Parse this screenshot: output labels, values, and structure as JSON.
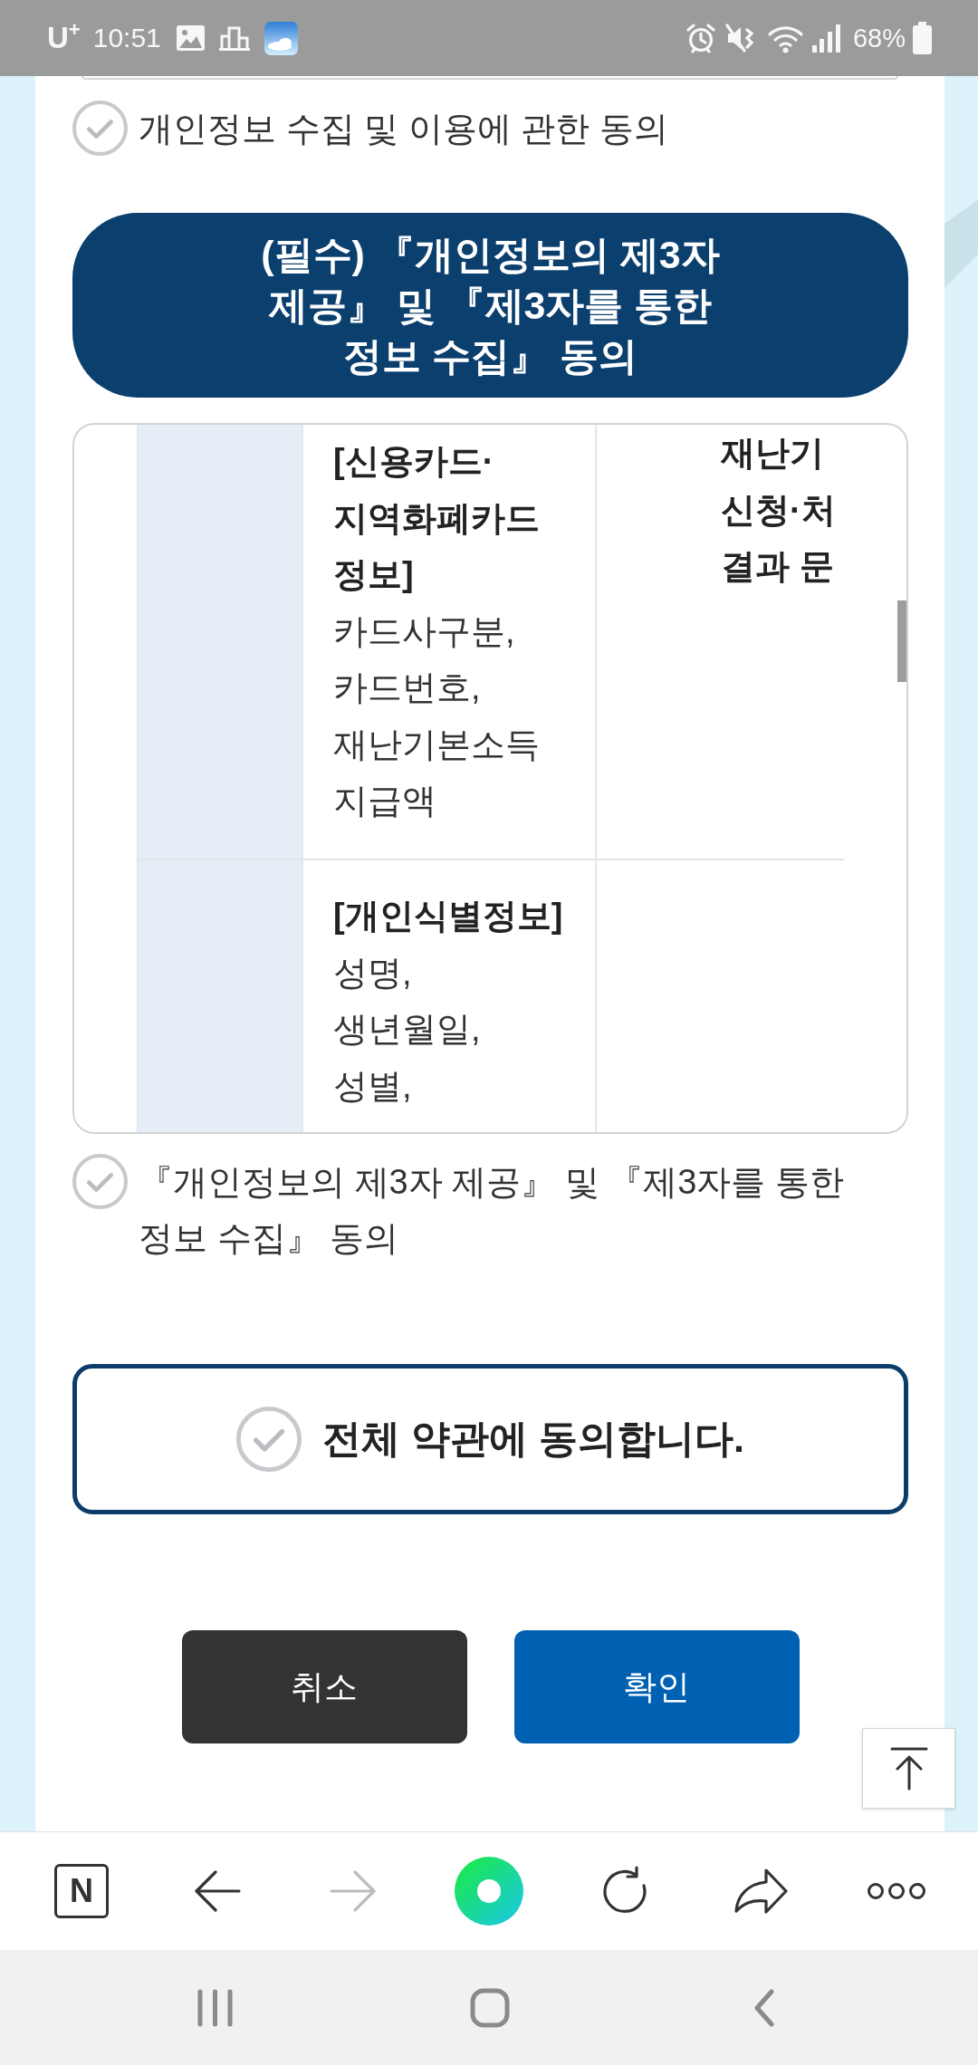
{
  "status_bar": {
    "carrier": "U$^{+}$",
    "time": "10:51",
    "battery": "68%"
  },
  "privacy_consent": {
    "label": "개인정보 수집 및 이용에 관한 동의",
    "checked": false
  },
  "third_party": {
    "title": "(필수) 『개인정보의 제3자 제공』 및 『제3자를 통한 정보 수집』 동의",
    "table": {
      "rows": [
        {
          "column_2": {
            "heading_lines": [
              "[신용카드·",
              "지역화폐카드",
              "정보]"
            ],
            "lines": [
              "카드사구분,",
              "카드번호,",
              "재난기본소득",
              "지급액"
            ]
          },
          "column_3": {
            "heading_lines": [
              "재난기",
              "신청·처",
              "결과 문"
            ]
          }
        },
        {
          "column_2": {
            "heading_lines": [
              "[개인식별정보]"
            ],
            "lines": [
              "성명,",
              "생년월일,",
              "성별,"
            ]
          }
        }
      ]
    },
    "consent": {
      "label": "『개인정보의 제3자 제공』 및 『제3자를 통한 정보 수집』 동의",
      "checked": false
    }
  },
  "agree_all": {
    "label": "전체 약관에 동의합니다.",
    "checked": false
  },
  "buttons": [
    {
      "label": "취소",
      "kind": "cancel"
    },
    {
      "label": "확인",
      "kind": "confirm"
    }
  ],
  "browser_toolbar": {
    "items": [
      {
        "kind": "home",
        "label": "N",
        "disabled": false
      },
      {
        "kind": "back",
        "disabled": false
      },
      {
        "kind": "forward",
        "disabled": true
      },
      {
        "kind": "assistant",
        "disabled": false
      },
      {
        "kind": "reload",
        "disabled": false
      },
      {
        "kind": "share",
        "disabled": false
      },
      {
        "kind": "more",
        "disabled": false
      }
    ]
  }
}
